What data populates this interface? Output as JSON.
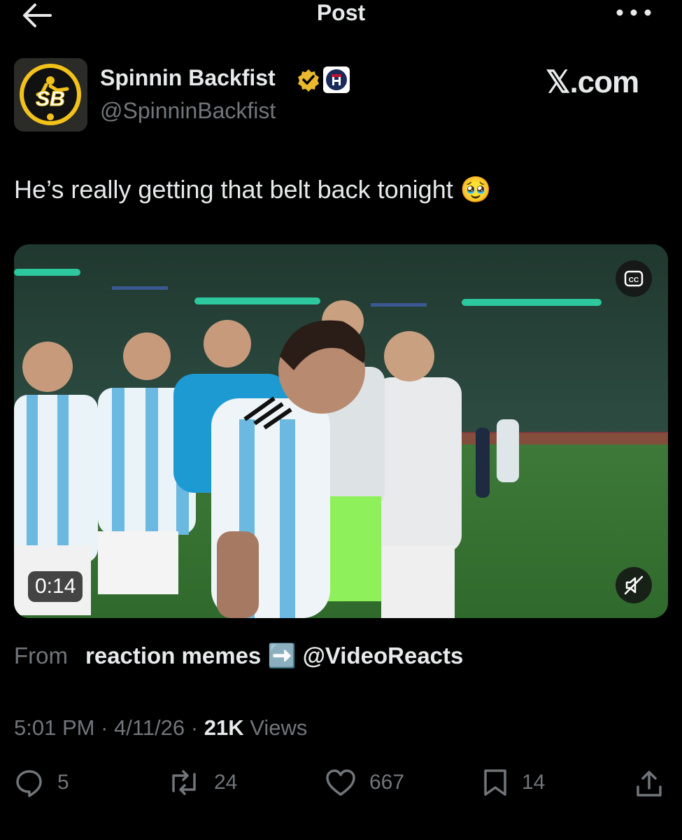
{
  "header": {
    "title": "Post"
  },
  "author": {
    "avatar_text": "SB",
    "name": "Spinnin Backfist",
    "handle": "@SpinninBackfist"
  },
  "brand": "𝕏.com",
  "post": {
    "text": "He’s really getting that belt back tonight 🥹"
  },
  "video": {
    "duration": "0:14",
    "cc_label": "CC"
  },
  "source": {
    "label": "From",
    "name": "reaction memes ➡️ @VideoReacts"
  },
  "meta": {
    "time": "5:01 PM",
    "date": "4/11/26",
    "views_count": "21K",
    "views_label": "Views"
  },
  "actions": {
    "replies": "5",
    "reposts": "24",
    "likes": "667",
    "bookmarks": "14"
  },
  "colors": {
    "background": "#000000",
    "text": "#e7e9ea",
    "muted": "#71767b",
    "verified": "#e8b92e"
  }
}
